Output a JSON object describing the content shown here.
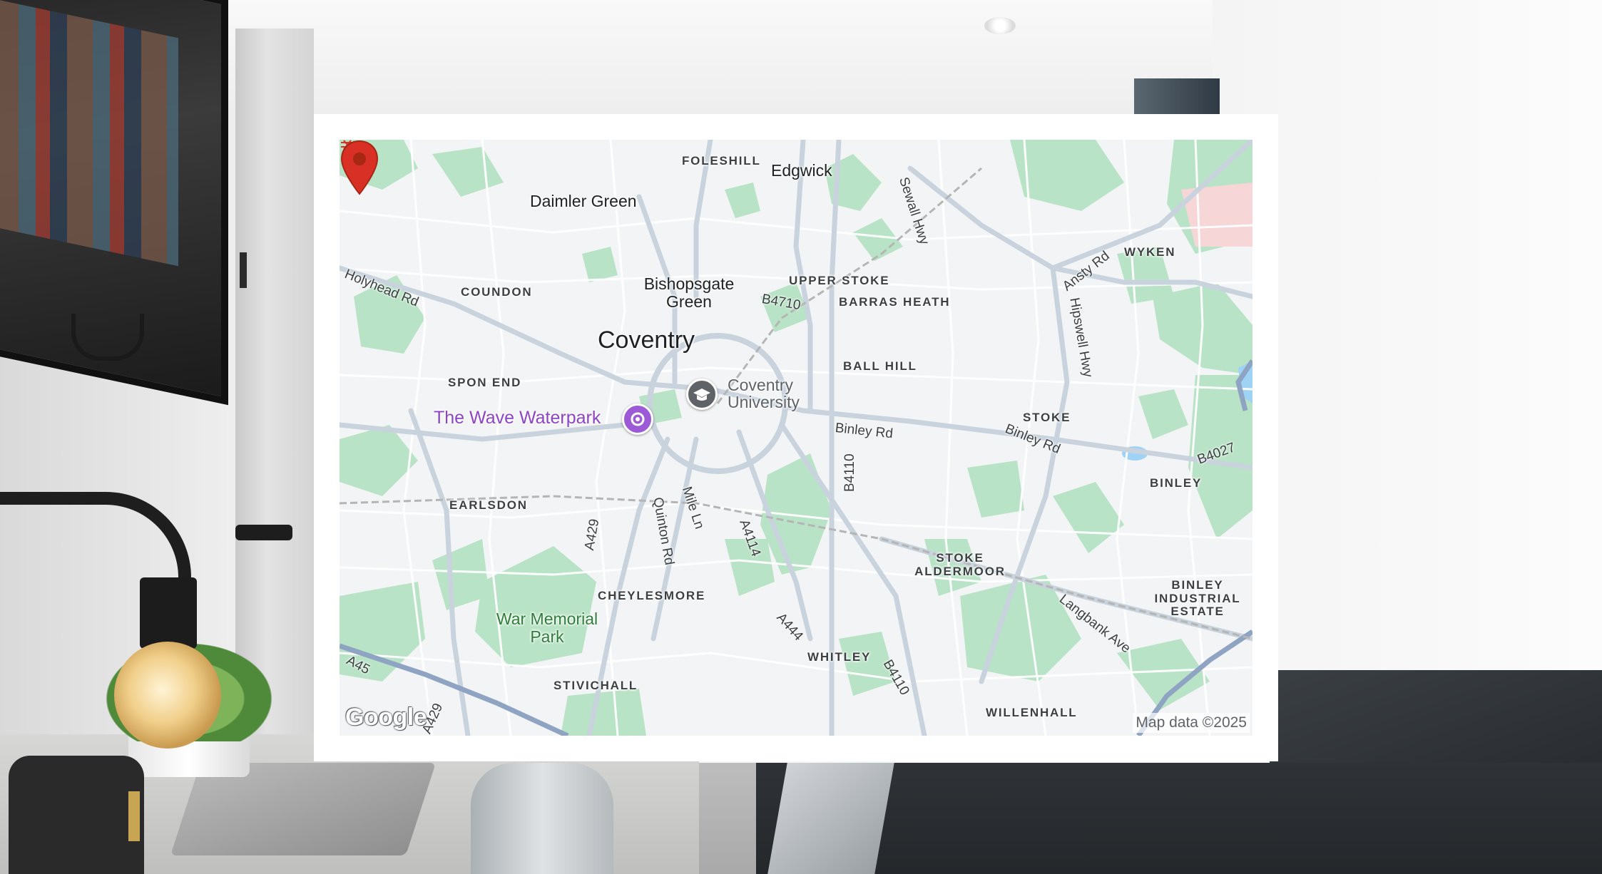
{
  "map": {
    "provider_logo": "Google",
    "attribution": "Map data ©2025",
    "pin_color": "#d93025",
    "park_color": "#a8dab5",
    "road_color": "#c7cfd8",
    "water_color": "#9fd3f5",
    "labels": {
      "foleshill": "FOLESHILL",
      "edgwick": "Edgwick",
      "sewall_hwy": "Sewall Hwy",
      "daimler_green": "Daimler Green",
      "wyken": "WYKEN",
      "ansty_rd": "Ansty Rd",
      "holyhead_rd": "Holyhead Rd",
      "coundon": "COUNDON",
      "bishopsgate_green": "Bishopsgate Green",
      "upper_stoke": "UPPER STOKE",
      "b4710": "B4710",
      "barras_heath": "BARRAS HEATH",
      "hipswell_hwy": "Hipswell Hwy",
      "coventry": "Coventry",
      "ball_hill": "BALL HILL",
      "spon_end": "SPON END",
      "coventry_university": "Coventry University",
      "the_wave": "The Wave Waterpark",
      "binley_rd_1": "Binley Rd",
      "stoke": "STOKE",
      "binley_rd_2": "Binley Rd",
      "b4027": "B4027",
      "b4110_1": "B4110",
      "binley": "BINLEY",
      "earlsdon": "EARLSDON",
      "a429_1": "A429",
      "quinton_rd": "Quinton Rd",
      "mile_ln": "Mile Ln",
      "a4114": "A4114",
      "stoke_aldermoor": "STOKE ALDERMOOR",
      "binley_industrial_estate": "BINLEY INDUSTRIAL ESTATE",
      "langbank_ave": "Langbank Ave",
      "cheylesmore": "CHEYLESMORE",
      "war_memorial_park": "War Memorial Park",
      "a444": "A444",
      "a45": "A45",
      "whitley": "WHITLEY",
      "b4110_2": "B4110",
      "stivichall": "STIVICHALL",
      "a429_2": "A429",
      "willenhall": "WILLENHALL"
    },
    "icons": {
      "location_pin": "map-pin-icon",
      "university": "graduation-cap-icon",
      "waterpark": "waterpark-icon",
      "railway_station": "rail-station-icon"
    }
  }
}
